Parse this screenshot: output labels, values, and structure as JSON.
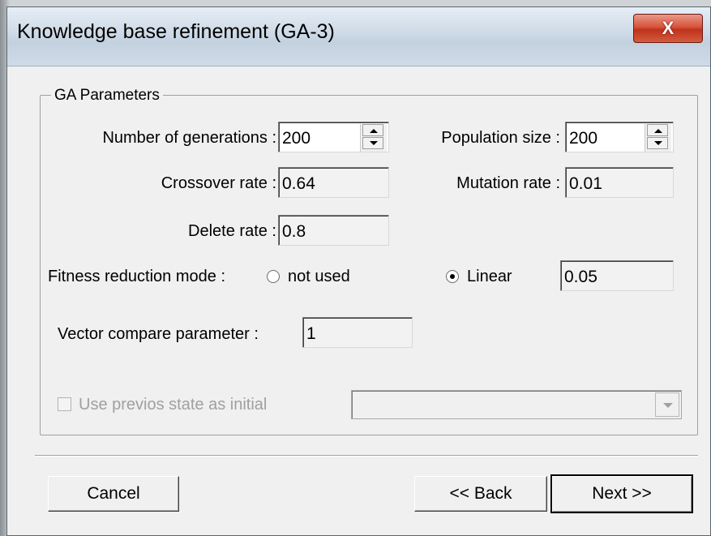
{
  "window": {
    "title": "Knowledge base refinement (GA-3)",
    "close_glyph": "X"
  },
  "group": {
    "legend": "GA Parameters"
  },
  "fields": {
    "generations_label": "Number of generations :",
    "generations_value": "200",
    "population_label": "Population size :",
    "population_value": "200",
    "crossover_label": "Crossover rate :",
    "crossover_value": "0.64",
    "mutation_label": "Mutation rate :",
    "mutation_value": "0.01",
    "delete_label": "Delete rate :",
    "delete_value": "0.8",
    "fitness_label": "Fitness reduction mode :",
    "fitness_option_not_used": "not used",
    "fitness_option_linear": "Linear",
    "fitness_selected": "Linear",
    "linear_value": "0.05",
    "vector_label": "Vector compare parameter :",
    "vector_value": "1",
    "use_previous_label": "Use previos state as initial",
    "use_previous_checked": false,
    "use_previous_enabled": false,
    "state_select_value": ""
  },
  "buttons": {
    "cancel": "Cancel",
    "back": "<< Back",
    "next": "Next >>"
  }
}
